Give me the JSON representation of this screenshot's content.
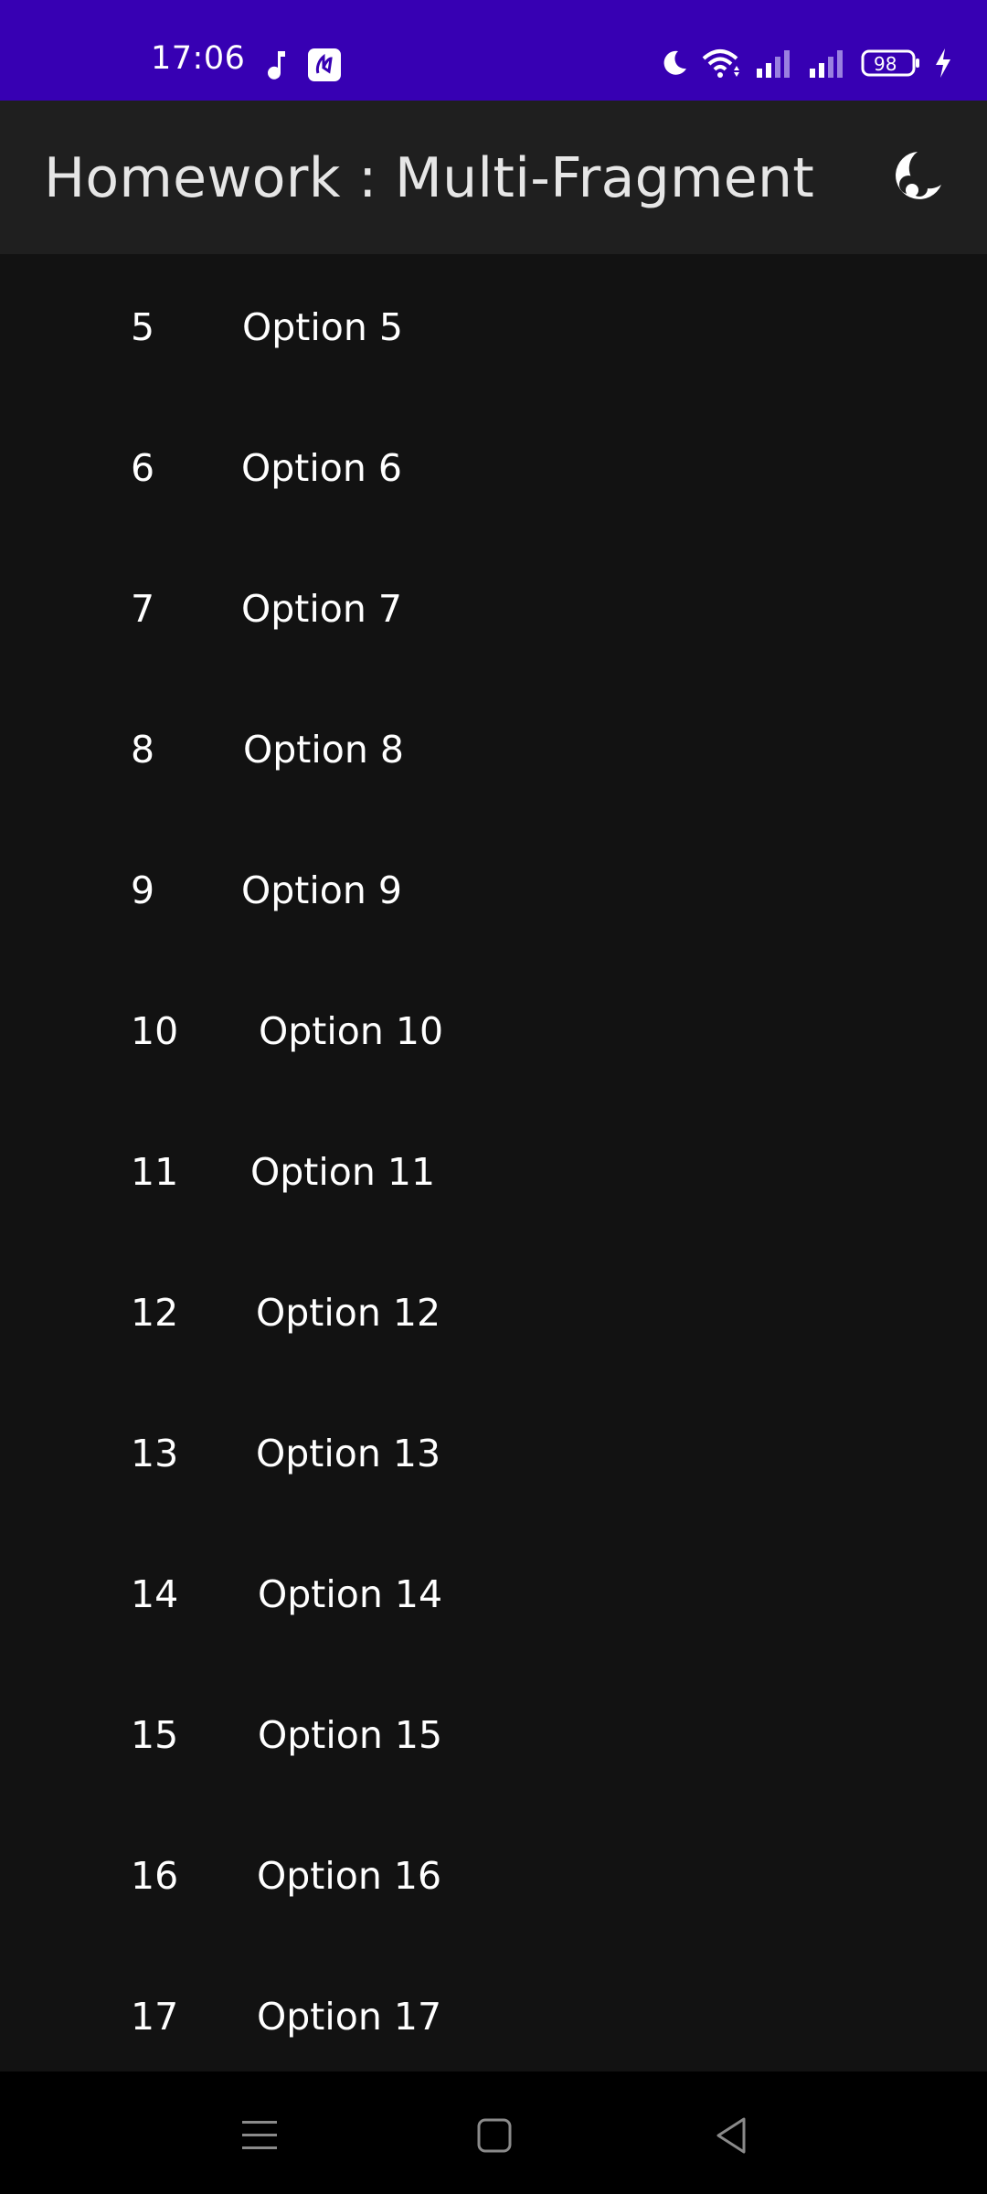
{
  "status_bar": {
    "time": "17:06",
    "battery": "98",
    "icons": [
      "music-note-icon",
      "notification-app-icon",
      "do-not-disturb-icon",
      "wifi-icon",
      "signal-icon",
      "signal-icon",
      "battery-icon",
      "charging-icon"
    ]
  },
  "app_bar": {
    "title": "Homework : Multi-Fragment",
    "action_icon": "night-mode-icon"
  },
  "list": {
    "items": [
      {
        "number": "5",
        "label": "Option 5"
      },
      {
        "number": "6",
        "label": "Option 6"
      },
      {
        "number": "7",
        "label": "Option 7"
      },
      {
        "number": "8",
        "label": "Option 8"
      },
      {
        "number": "9",
        "label": "Option 9"
      },
      {
        "number": "10",
        "label": "Option 10"
      },
      {
        "number": "11",
        "label": "Option 11"
      },
      {
        "number": "12",
        "label": "Option 12"
      },
      {
        "number": "13",
        "label": "Option 13"
      },
      {
        "number": "14",
        "label": "Option 14"
      },
      {
        "number": "15",
        "label": "Option 15"
      },
      {
        "number": "16",
        "label": "Option 16"
      },
      {
        "number": "17",
        "label": "Option 17"
      }
    ]
  },
  "nav_bar": {
    "icons": [
      "menu-icon",
      "home-icon",
      "back-icon"
    ]
  },
  "colors": {
    "status_bar": "#3700b3",
    "app_bar": "#1f1f1f",
    "background": "#121212",
    "nav_bar": "#000000"
  }
}
